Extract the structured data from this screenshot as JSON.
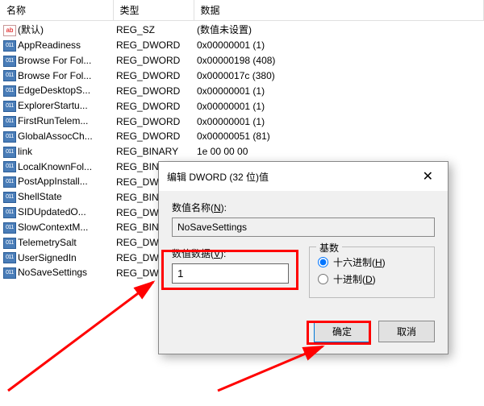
{
  "headers": {
    "name": "名称",
    "type": "类型",
    "data": "数据"
  },
  "rows": [
    {
      "icon": "string",
      "name": "(默认)",
      "type": "REG_SZ",
      "data": "(数值未设置)"
    },
    {
      "icon": "dword",
      "name": "AppReadiness",
      "type": "REG_DWORD",
      "data": "0x00000001 (1)"
    },
    {
      "icon": "dword",
      "name": "Browse For Fol...",
      "type": "REG_DWORD",
      "data": "0x00000198 (408)"
    },
    {
      "icon": "dword",
      "name": "Browse For Fol...",
      "type": "REG_DWORD",
      "data": "0x0000017c (380)"
    },
    {
      "icon": "dword",
      "name": "EdgeDesktopS...",
      "type": "REG_DWORD",
      "data": "0x00000001 (1)"
    },
    {
      "icon": "dword",
      "name": "ExplorerStartu...",
      "type": "REG_DWORD",
      "data": "0x00000001 (1)"
    },
    {
      "icon": "dword",
      "name": "FirstRunTelem...",
      "type": "REG_DWORD",
      "data": "0x00000001 (1)"
    },
    {
      "icon": "dword",
      "name": "GlobalAssocCh...",
      "type": "REG_DWORD",
      "data": "0x00000051 (81)"
    },
    {
      "icon": "dword",
      "name": "link",
      "type": "REG_BINARY",
      "data": "1e 00 00 00"
    },
    {
      "icon": "dword",
      "name": "LocalKnownFol...",
      "type": "REG_BINARY",
      "data": ""
    },
    {
      "icon": "dword",
      "name": "PostAppInstall...",
      "type": "REG_DWORD",
      "data": ""
    },
    {
      "icon": "dword",
      "name": "ShellState",
      "type": "REG_BINARY",
      "data": ""
    },
    {
      "icon": "dword",
      "name": "SIDUpdatedO...",
      "type": "REG_DWORD",
      "data": ""
    },
    {
      "icon": "dword",
      "name": "SlowContextM...",
      "type": "REG_BINARY",
      "data": ""
    },
    {
      "icon": "dword",
      "name": "TelemetrySalt",
      "type": "REG_DWORD",
      "data": ""
    },
    {
      "icon": "dword",
      "name": "UserSignedIn",
      "type": "REG_DWORD",
      "data": ""
    },
    {
      "icon": "dword",
      "name": "NoSaveSettings",
      "type": "REG_DWORD",
      "data": ""
    }
  ],
  "dialog": {
    "title": "编辑 DWORD (32 位)值",
    "name_label_pre": "数值名称(",
    "name_label_u": "N",
    "name_label_post": "):",
    "name_value": "NoSaveSettings",
    "data_label_pre": "数值数据(",
    "data_label_u": "V",
    "data_label_post": "):",
    "data_value": "1",
    "radix_label": "基数",
    "radix_hex_pre": "十六进制(",
    "radix_hex_u": "H",
    "radix_hex_post": ")",
    "radix_dec_pre": "十进制(",
    "radix_dec_u": "D",
    "radix_dec_post": ")",
    "ok": "确定",
    "cancel": "取消"
  }
}
